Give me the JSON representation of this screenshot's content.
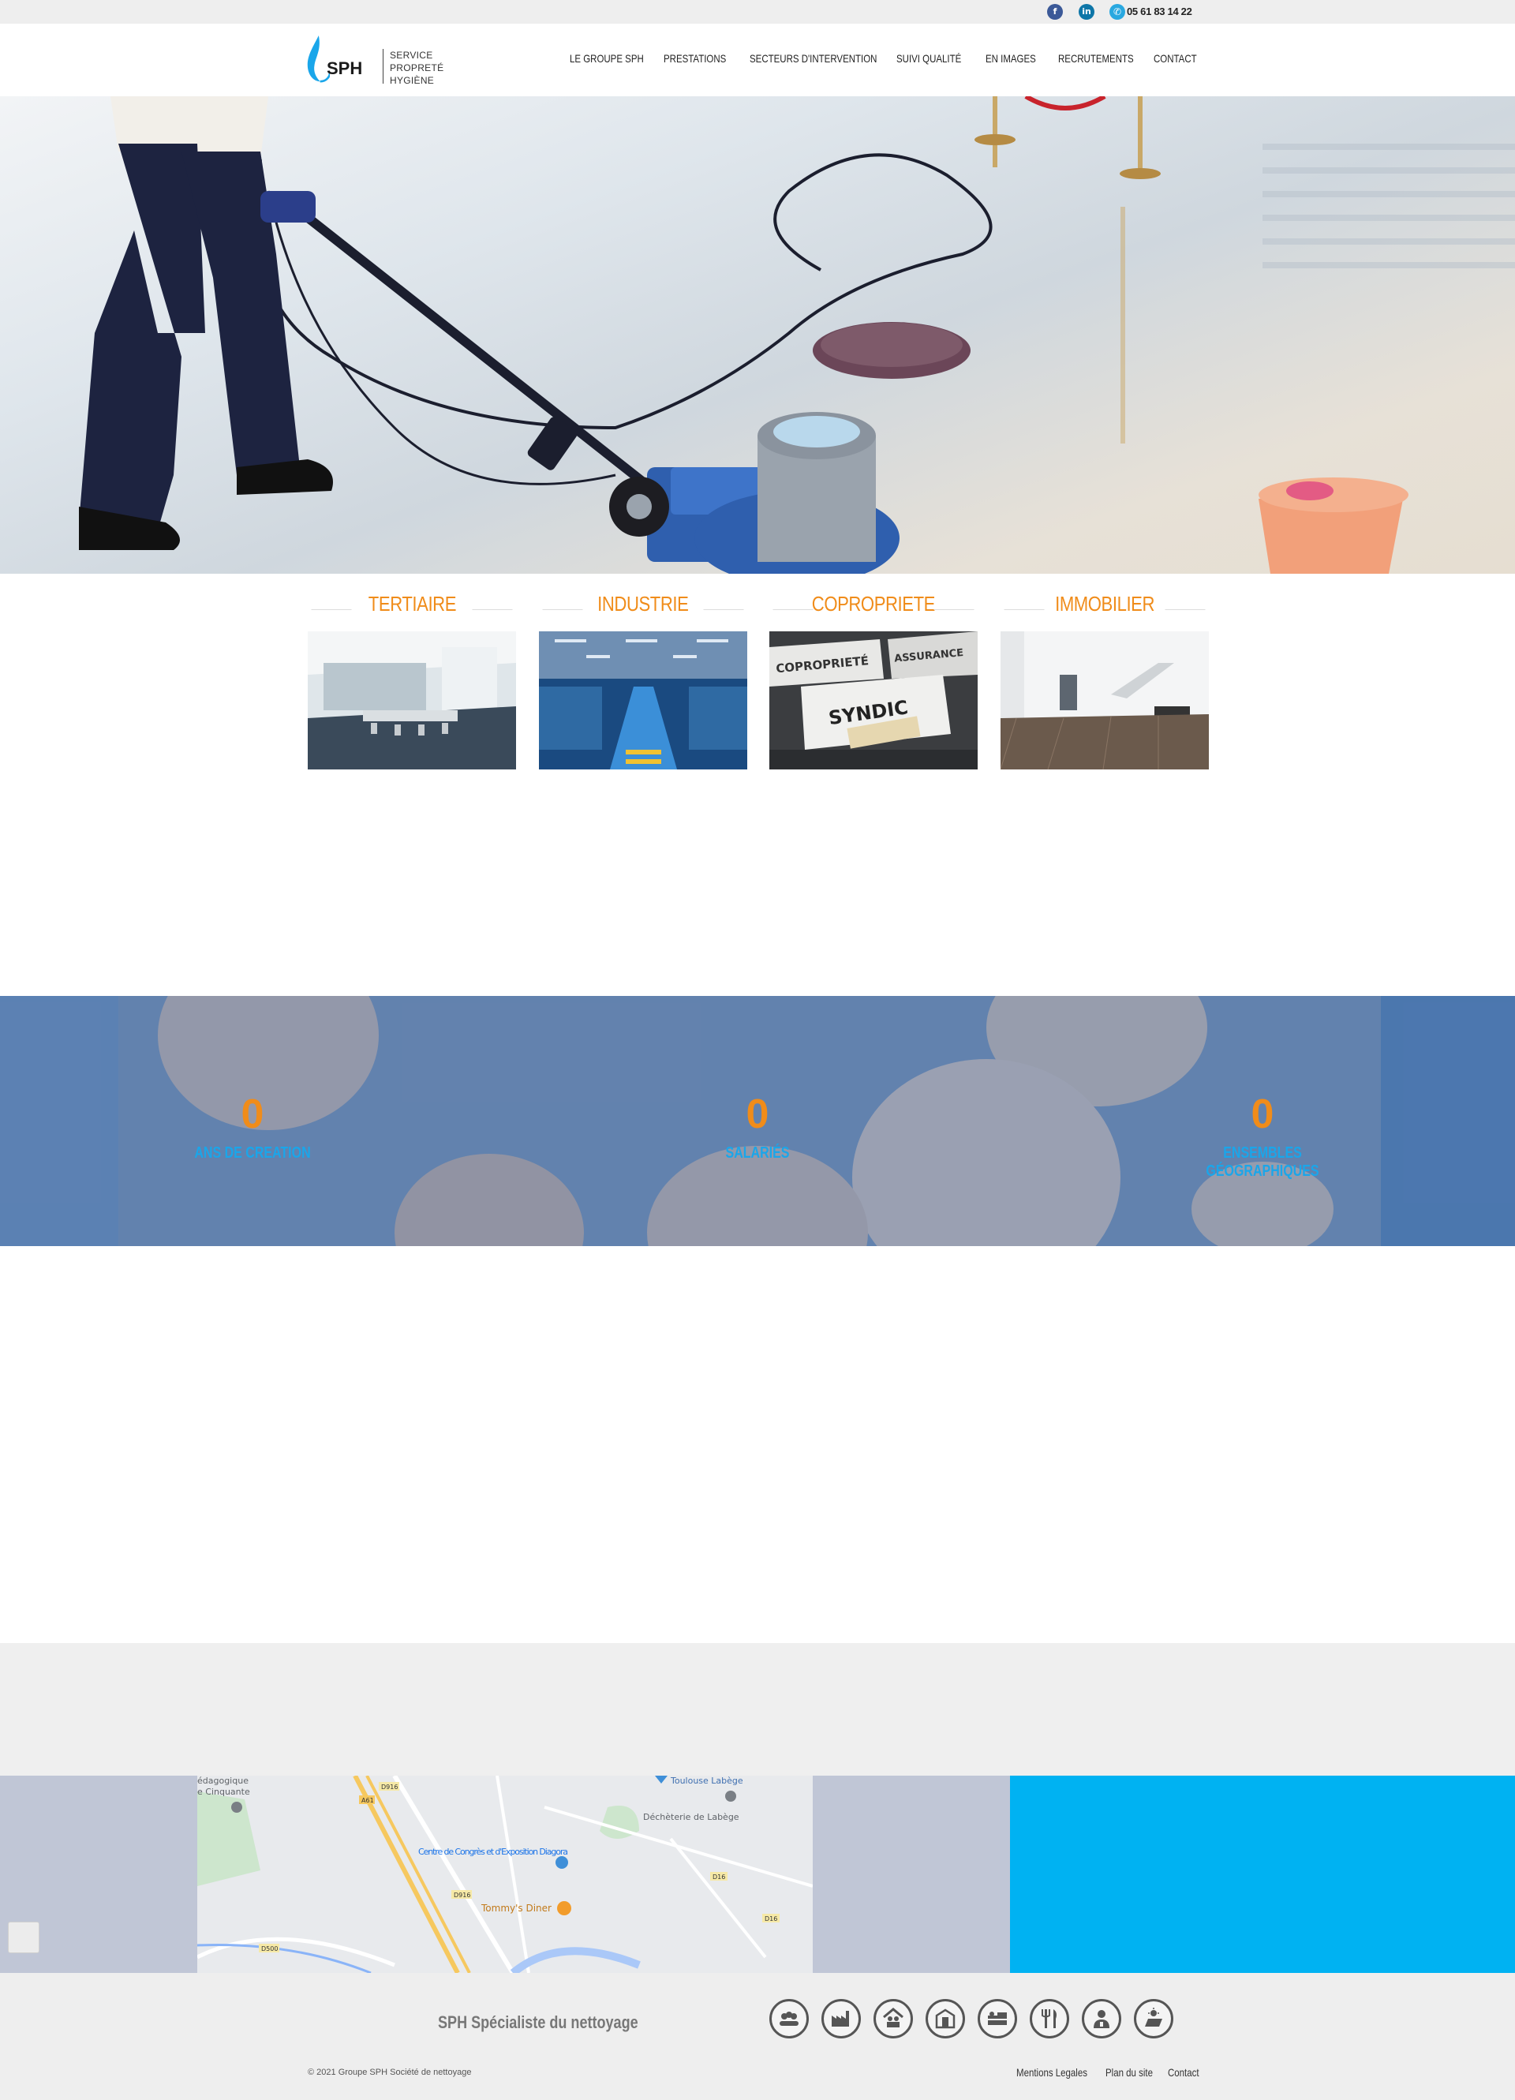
{
  "topbar": {
    "facebook_icon": "facebook-icon",
    "linkedin_icon": "linkedin-icon",
    "phone_icon": "phone-icon",
    "phone": "05 61 83 14 22"
  },
  "brand": {
    "short": "SPH",
    "line1": "SERVICE",
    "line2": "PROPRETÉ",
    "line3": "HYGIÈNE",
    "accent": "#1aa6ea",
    "orange": "#f08c1a"
  },
  "nav": [
    "LE GROUPE SPH",
    "PRESTATIONS",
    "SECTEURS D'INTERVENTION",
    "SUIVI QUALITÉ",
    "EN IMAGES",
    "RECRUTEMENTS",
    "CONTACT"
  ],
  "sectors": [
    {
      "title": "TERTIAIRE"
    },
    {
      "title": "INDUSTRIE"
    },
    {
      "title": "COPROPRIETE"
    },
    {
      "title": "IMMOBILIER",
      "signs": [
        "COPROPRIETÉ",
        "ASSURANCE",
        "SYNDIC"
      ]
    }
  ],
  "copro_signs": [
    "COPROPRIETÉ",
    "ASSURANCE",
    "SYNDIC"
  ],
  "stats": [
    {
      "value": "0",
      "label": "ANS DE CREATION"
    },
    {
      "value": "0",
      "label": "SALARIÉS"
    },
    {
      "value": "0",
      "label": "ENSEMBLES GÉOGRAPHIQUES"
    }
  ],
  "map": {
    "places": [
      "Toulouse Labège",
      "Déchèterie de Labège",
      "Centre de Congrès et d'Exposition Diagora",
      "Tommy's Diner",
      "édagogique",
      "e Cinquante"
    ],
    "roads": [
      "D916",
      "A61",
      "D16",
      "D916",
      "D16",
      "D500"
    ]
  },
  "footer": {
    "slogan": "SPH Spécialiste du nettoyage",
    "icons": [
      "people-icon",
      "factory-icon",
      "family-icon",
      "building-icon",
      "hospital-bed-icon",
      "cutlery-icon",
      "doctor-icon",
      "solar-panel-icon"
    ],
    "copyright": "© 2021 Groupe SPH Société de nettoyage",
    "links": [
      "Mentions Legales",
      "Plan du site",
      "Contact"
    ]
  }
}
